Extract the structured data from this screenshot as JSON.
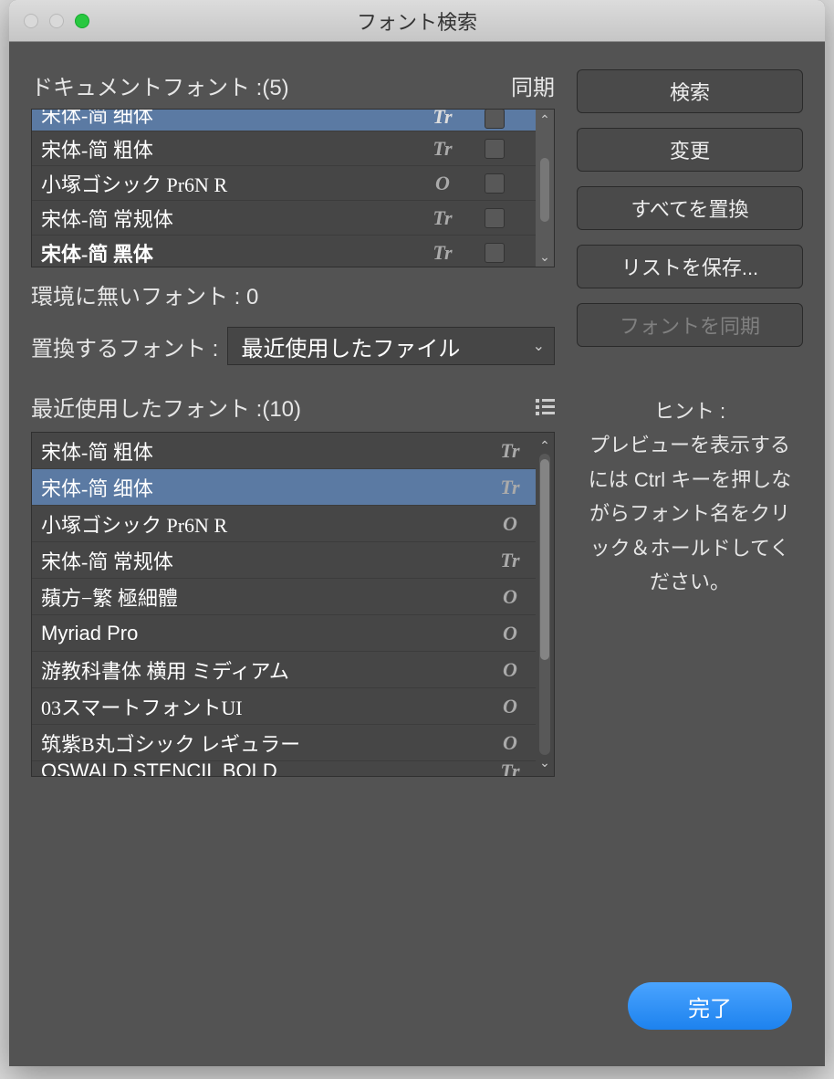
{
  "window": {
    "title": "フォント検索"
  },
  "doc_fonts": {
    "label": "ドキュメントフォント :(5)",
    "sync_label": "同期",
    "items": [
      {
        "name": "宋体-简 细体",
        "type": "Tr",
        "selected": true,
        "cut": true
      },
      {
        "name": "宋体-简 粗体",
        "type": "Tr",
        "selected": false
      },
      {
        "name": "小塚ゴシック Pr6N R",
        "type": "O",
        "selected": false
      },
      {
        "name": "宋体-简 常规体",
        "type": "Tr",
        "selected": false
      },
      {
        "name": "宋体-简 黑体",
        "type": "Tr",
        "selected": false,
        "bold": true
      }
    ]
  },
  "missing_label": "環境に無いフォント : 0",
  "replace": {
    "label": "置換するフォント :",
    "value": "最近使用したファイル"
  },
  "recent": {
    "label": "最近使用したフォント :(10)",
    "items": [
      {
        "name": "宋体-简 粗体",
        "type": "Tr"
      },
      {
        "name": "宋体-简 细体",
        "type": "Tr",
        "selected": true
      },
      {
        "name": "小塚ゴシック Pr6N R",
        "type": "O"
      },
      {
        "name": "宋体-简 常规体",
        "type": "Tr"
      },
      {
        "name": "蘋方−繁 極細體",
        "type": "O"
      },
      {
        "name": "Myriad Pro",
        "type": "O",
        "sans": true
      },
      {
        "name": "游教科書体 横用 ミディアム",
        "type": "O"
      },
      {
        "name": "03スマートフォントUI",
        "type": "O"
      },
      {
        "name": "筑紫B丸ゴシック レギュラー",
        "type": "O"
      },
      {
        "name": "OSWALD STENCIL BOLD",
        "type": "Tr",
        "sans": true,
        "cut": true
      }
    ]
  },
  "buttons": {
    "search": "検索",
    "change": "変更",
    "replace_all": "すべてを置換",
    "save_list": "リストを保存...",
    "sync_fonts": "フォントを同期",
    "done": "完了"
  },
  "hint": {
    "title": "ヒント :",
    "body": "プレビューを表示するには Ctrl キーを押しながらフォント名をクリック＆ホールドしてください。"
  }
}
